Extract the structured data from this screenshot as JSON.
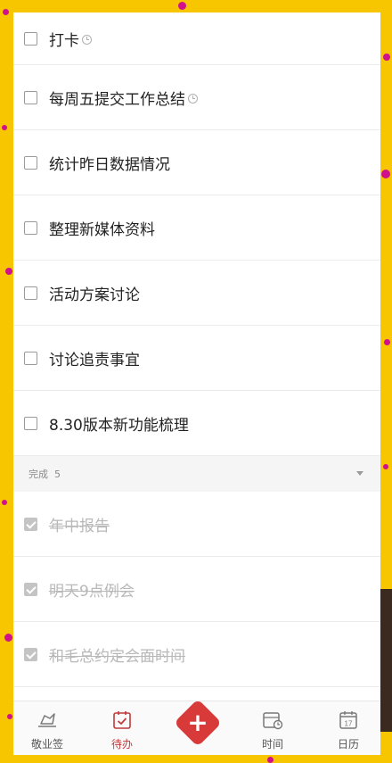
{
  "todos": [
    {
      "label": "打卡",
      "reminder": true,
      "done": false
    },
    {
      "label": "每周五提交工作总结",
      "reminder": true,
      "done": false
    },
    {
      "label": "统计昨日数据情况",
      "reminder": false,
      "done": false
    },
    {
      "label": "整理新媒体资料",
      "reminder": false,
      "done": false
    },
    {
      "label": "活动方案讨论",
      "reminder": false,
      "done": false
    },
    {
      "label": "讨论追责事宜",
      "reminder": false,
      "done": false
    },
    {
      "label": "8.30版本新功能梳理",
      "reminder": false,
      "done": false
    }
  ],
  "completed_section": {
    "label": "完成",
    "count": "5"
  },
  "completed": [
    {
      "label": "年中报告",
      "done": true
    },
    {
      "label": "明天9点例会",
      "done": true
    },
    {
      "label": "和毛总约定会面时间",
      "done": true
    }
  ],
  "nav": {
    "memo": "敬业签",
    "todo": "待办",
    "add": "+",
    "time": "时间",
    "calendar": "日历",
    "calendar_day": "17"
  },
  "colors": {
    "accent": "#d83a3a",
    "active_tab": "#c03a3a",
    "background": "#f7c600"
  },
  "icons": {
    "memo": "pen-icon",
    "todo": "checklist-icon",
    "add": "plus-icon",
    "time": "clock-calendar-icon",
    "calendar": "calendar-icon"
  }
}
